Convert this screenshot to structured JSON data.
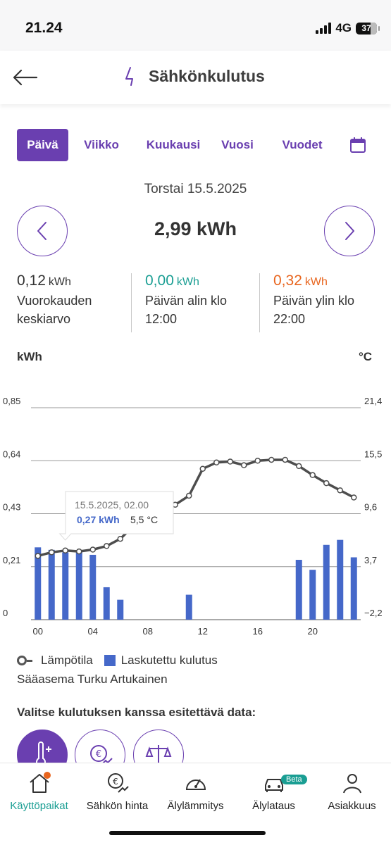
{
  "status": {
    "time": "21.24",
    "network": "4G",
    "battery": "37"
  },
  "header": {
    "title": "Sähkönkulutus"
  },
  "tabs": [
    {
      "label": "Päivä",
      "active": true
    },
    {
      "label": "Viikko",
      "active": false
    },
    {
      "label": "Kuukausi",
      "active": false
    },
    {
      "label": "Vuosi",
      "active": false
    },
    {
      "label": "Vuodet",
      "active": false
    }
  ],
  "date": "Torstai 15.5.2025",
  "total": "2,99 kWh",
  "stats": [
    {
      "value": "0,12",
      "unit": "kWh",
      "line1": "Vuorokauden",
      "line2": "keskiarvo",
      "color": "#333333"
    },
    {
      "value": "0,00",
      "unit": "kWh",
      "line1": "Päivän alin klo",
      "line2": "12:00",
      "color": "#1a9e93"
    },
    {
      "value": "0,32",
      "unit": "kWh",
      "line1": "Päivän ylin klo",
      "line2": "22:00",
      "color": "#e8651e"
    }
  ],
  "chart_axes": {
    "left_title": "kWh",
    "right_title": "°C"
  },
  "chart_data": {
    "type": "bar",
    "x_labels": [
      "00",
      "04",
      "08",
      "12",
      "16",
      "20"
    ],
    "y_left_ticks": [
      "0",
      "0,21",
      "0,43",
      "0,64",
      "0,85"
    ],
    "y_right_ticks": [
      "−2,2",
      "3,7",
      "9,6",
      "15,5",
      "21,4"
    ],
    "ylim_left": [
      0,
      0.85
    ],
    "ylim_right": [
      -2.2,
      21.4
    ],
    "series": [
      {
        "name": "Laskutettu kulutus",
        "type": "bar",
        "axis": "left",
        "values": [
          0.29,
          0.28,
          0.27,
          0.27,
          0.26,
          0.13,
          0.08,
          0,
          0,
          0,
          0,
          0.1,
          0,
          0,
          0,
          0,
          0,
          0,
          0,
          0.24,
          0.2,
          0.3,
          0.32,
          0.25
        ]
      },
      {
        "name": "Lämpötila",
        "type": "line",
        "axis": "right",
        "values": [
          4.9,
          5.3,
          5.5,
          5.4,
          5.6,
          6.0,
          6.8,
          8.3,
          9.1,
          9.6,
          10.6,
          11.6,
          14.6,
          15.3,
          15.4,
          15.0,
          15.5,
          15.6,
          15.6,
          14.9,
          13.9,
          13.0,
          12.2,
          11.4
        ]
      }
    ],
    "tooltip": {
      "title": "15.5.2025, 02.00",
      "kwh": "0,27 kWh",
      "temp": "5,5 °C"
    },
    "colors": {
      "bar": "#4568c9",
      "line": "#4d4d4d",
      "accent": "#6a3fb0"
    }
  },
  "legend": {
    "temperature": "Lämpötila",
    "consumption": "Laskutettu kulutus"
  },
  "station": "Sääasema Turku Artukainen",
  "choose_data": "Valitse kulutuksen kanssa esitettävä data:",
  "nav": [
    {
      "label": "Käyttöpaikat",
      "icon": "home-icon",
      "active": true
    },
    {
      "label": "Sähkön hinta",
      "icon": "euro-trend-icon",
      "active": false
    },
    {
      "label": "Älylämmitys",
      "icon": "gauge-icon",
      "active": false
    },
    {
      "label": "Älylataus",
      "icon": "car-icon",
      "active": false,
      "badge": "Beta"
    },
    {
      "label": "Asiakkuus",
      "icon": "person-icon",
      "active": false
    }
  ]
}
